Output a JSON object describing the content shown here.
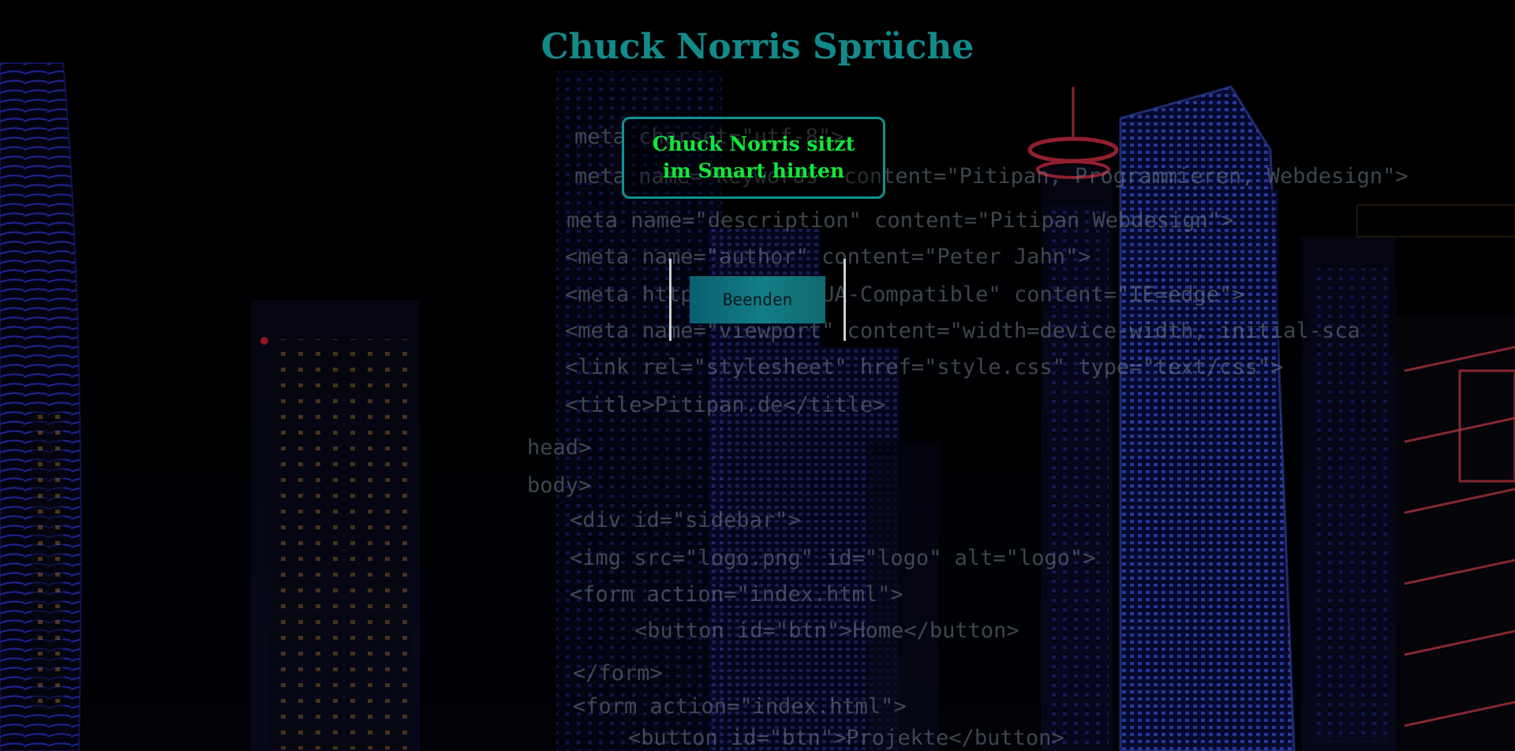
{
  "header": {
    "title": "Chuck Norris Sprüche"
  },
  "quote": {
    "text": "Chuck Norris sitzt im Smart hinten"
  },
  "actions": {
    "end_label": "Beenden"
  },
  "background": {
    "code_lines": [
      "meta charset=\"utf-8\">",
      "meta name=\"keywords\" content=\"Pitipan, Programmieren, Webdesign\">",
      "meta name=\"description\" content=\"Pitipan Webdesign\">",
      "<meta name=\"author\" content=\"Peter Jahn\">",
      "<meta http-equiv=\"X-UA-Compatible\" content=\"IE=edge\">",
      "<meta name=\"viewport\" content=\"width=device-width, initial-sca",
      "<link rel=\"stylesheet\" href=\"style.css\" type=\"text/css\">",
      "<title>Pitipan.de</title>",
      "head>",
      "body>",
      "<div id=\"sidebar\">",
      "<img src=\"logo.png\" id=\"logo\" alt=\"logo\">",
      "<form action=\"index.html\">",
      "<button id=\"btn\">Home</button>",
      "</form>",
      "<form action=\"index.html\">",
      "<button id=\"btn\">Projekte</button>"
    ],
    "colors": {
      "sky": "#000000",
      "building_blue": "#2a2ad6",
      "building_red": "#e0304a",
      "window_warm": "#f3b23a",
      "code_text": "#5f6f77"
    }
  }
}
